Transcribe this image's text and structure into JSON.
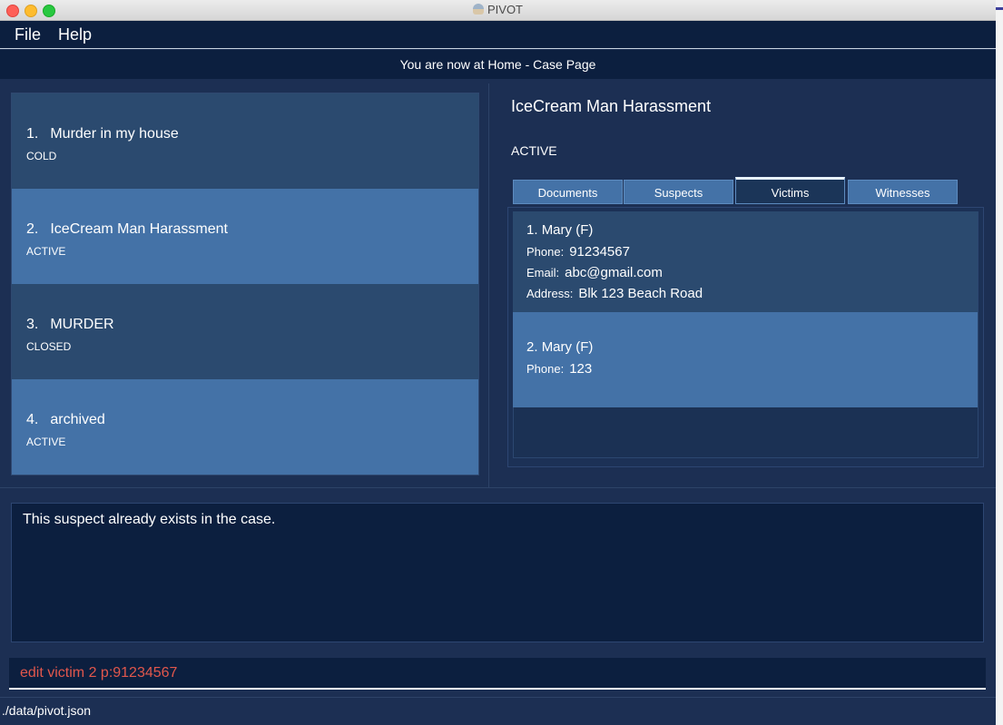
{
  "window": {
    "title": "PIVOT"
  },
  "menu": {
    "file": "File",
    "help": "Help"
  },
  "breadcrumb": "You are now at Home - Case Page",
  "cases": [
    {
      "index": "1.",
      "title": "Murder in my house",
      "status": "COLD"
    },
    {
      "index": "2.",
      "title": "IceCream Man Harassment",
      "status": "ACTIVE"
    },
    {
      "index": "3.",
      "title": "MURDER",
      "status": "CLOSED"
    },
    {
      "index": "4.",
      "title": "archived",
      "status": "ACTIVE"
    }
  ],
  "detail": {
    "title": "IceCream Man Harassment",
    "status": "ACTIVE",
    "tabs": [
      "Documents",
      "Suspects",
      "Victims",
      "Witnesses"
    ],
    "active_tab": "Victims",
    "victims": [
      {
        "index": "1.",
        "name": "Mary",
        "gender": "(F)",
        "phone_label": "Phone:",
        "phone": "91234567",
        "email_label": "Email:",
        "email": "abc@gmail.com",
        "address_label": "Address:",
        "address": "Blk 123 Beach Road"
      },
      {
        "index": "2.",
        "name": "Mary",
        "gender": "(F)",
        "phone_label": "Phone:",
        "phone": "123"
      }
    ]
  },
  "result": "This suspect already exists in the case.",
  "command": "edit victim 2 p:91234567",
  "status_bar": "./data/pivot.json",
  "colors": {
    "background": "#1c2f53",
    "dark_panel": "#0c1f3f",
    "card_dark": "#2b4a6f",
    "card_light": "#4472a7",
    "command_text": "#e2574c"
  }
}
